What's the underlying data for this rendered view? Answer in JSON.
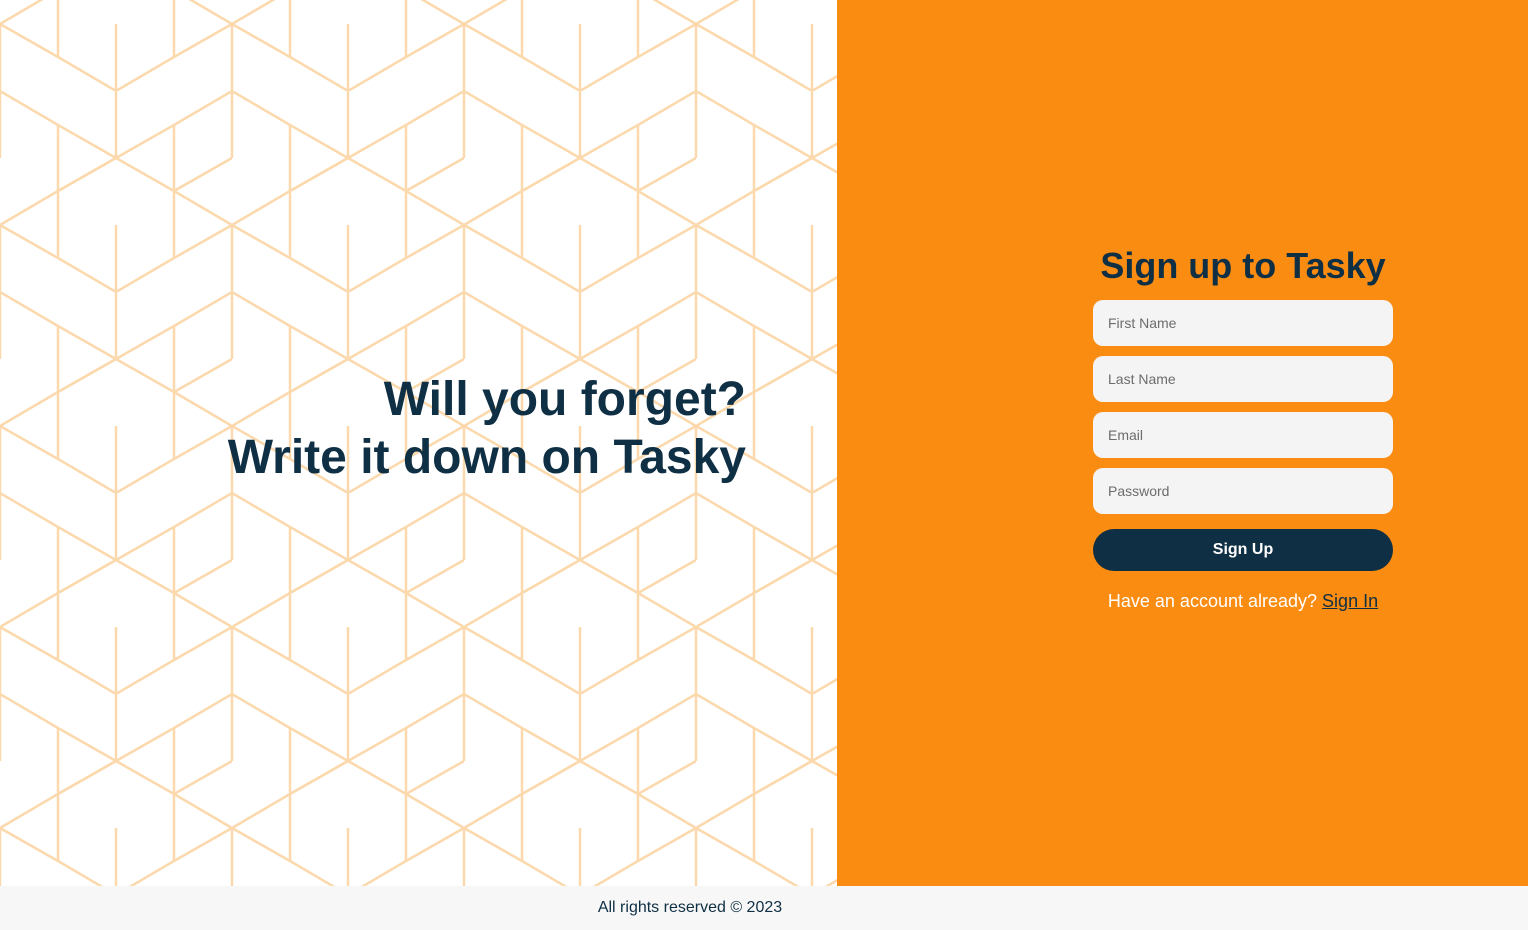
{
  "hero": {
    "tagline_line1": "Will you forget?",
    "tagline_line2": "Write it down on Tasky"
  },
  "signup": {
    "title": "Sign up to Tasky",
    "first_name_placeholder": "First Name",
    "last_name_placeholder": "Last Name",
    "email_placeholder": "Email",
    "password_placeholder": "Password",
    "submit_label": "Sign Up",
    "have_account_text": "Have an account already?",
    "signin_link": "Sign In"
  },
  "footer": {
    "text": "All rights reserved © 2023"
  },
  "colors": {
    "accent": "#fa8c12",
    "primary": "#0e2f44",
    "pattern_stroke": "#fbd9ad"
  }
}
